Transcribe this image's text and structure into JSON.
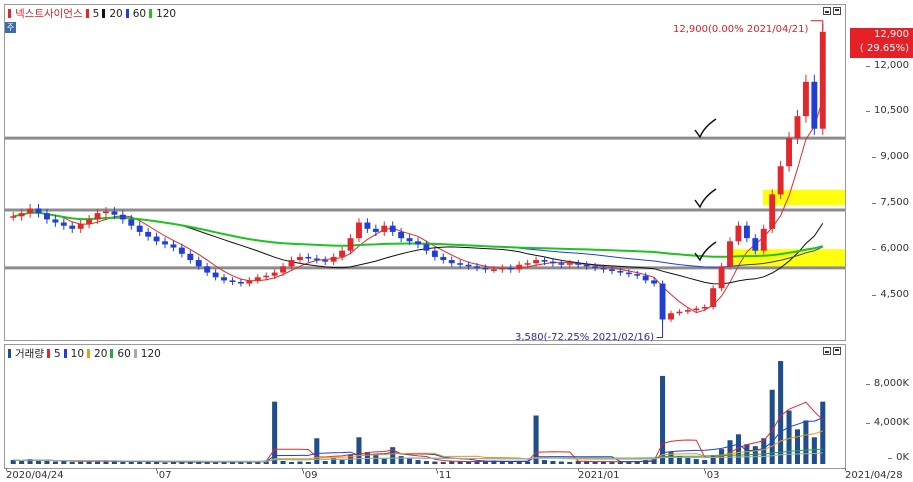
{
  "price_legend": {
    "stock_name": "넥스트사이언스",
    "ma": [
      {
        "label": "5",
        "color": "#e0282d"
      },
      {
        "label": "20",
        "color": "#111111"
      },
      {
        "label": "60",
        "color": "#1f3fd6"
      },
      {
        "label": "120",
        "color": "#1fc21f"
      }
    ]
  },
  "volume_legend": {
    "title": "거래량",
    "ma": [
      {
        "label": "5",
        "color": "#e0282d"
      },
      {
        "label": "10",
        "color": "#1f3fd6"
      },
      {
        "label": "20",
        "color": "#e79b18"
      },
      {
        "label": "60",
        "color": "#22a845"
      },
      {
        "label": "120",
        "color": "#a9a9a9"
      }
    ]
  },
  "side_icon": "주",
  "annotations": {
    "high": "12,900(0.00% 2021/04/21)",
    "low": "3,580(-72.25% 2021/02/16)"
  },
  "current_price": {
    "price": "12,900",
    "change": "( 29.65%)"
  },
  "price_axis_labels": [
    "12,000",
    "10,500",
    "9,000",
    "7,500",
    "6,000",
    "4,500"
  ],
  "volume_axis_labels": [
    "8,000K",
    "4,000K",
    "0K"
  ],
  "date_labels": [
    "2020/04/24",
    "'07",
    "'09",
    "'11",
    "2021/01",
    "'03",
    "2021/04/28"
  ],
  "colors": {
    "up": "#e0282d",
    "down": "#1f3fd6",
    "volume_bar": "#1f4e8a",
    "hline": "#8c8c8c",
    "highlight": "#ffff00"
  },
  "chart_data": [
    {
      "type": "candlestick",
      "title": "넥스트사이언스",
      "series_names": [
        "5",
        "20",
        "60",
        "120"
      ],
      "date_range": [
        "2020-04-24",
        "2021-04-28"
      ],
      "ylim": [
        3300,
        13500
      ],
      "close": [
        7000,
        7100,
        7250,
        7100,
        6900,
        6800,
        6700,
        6600,
        6750,
        6900,
        7100,
        7150,
        7050,
        6900,
        6700,
        6500,
        6350,
        6200,
        6100,
        6000,
        5800,
        5600,
        5400,
        5200,
        5050,
        4950,
        4900,
        4850,
        4950,
        5050,
        5100,
        5200,
        5400,
        5600,
        5700,
        5650,
        5600,
        5550,
        5700,
        5900,
        6300,
        6800,
        6600,
        6500,
        6700,
        6500,
        6300,
        6200,
        6100,
        5900,
        5700,
        5600,
        5500,
        5450,
        5400,
        5350,
        5300,
        5300,
        5350,
        5300,
        5450,
        5500,
        5600,
        5550,
        5500,
        5450,
        5500,
        5450,
        5400,
        5350,
        5300,
        5250,
        5200,
        5150,
        5100,
        4950,
        4850,
        3700,
        3900,
        3950,
        4000,
        4050,
        4100,
        4700,
        5400,
        6200,
        6700,
        6300,
        5900,
        6600,
        7700,
        8600,
        9500,
        10200,
        11300,
        9800,
        12900
      ],
      "annotations": [
        {
          "text": "12,900(0.00% 2021/04/21)",
          "date": "2021-04-21",
          "value": 12900
        },
        {
          "text": "3,580(-72.25% 2021/02/16)",
          "date": "2021-02-16",
          "value": 3580
        }
      ],
      "horizontal_lines": [
        9500,
        7200,
        5350
      ],
      "highlight_zones": [
        [
          7350,
          7850
        ],
        [
          5400,
          5950
        ]
      ],
      "current_price": 12900,
      "current_change_pct": 29.65
    },
    {
      "type": "bar",
      "title": "거래량",
      "unit": "K",
      "series_names": [
        "5",
        "10",
        "20",
        "60",
        "120"
      ],
      "ylim": [
        0,
        10000
      ],
      "values": [
        400,
        300,
        500,
        350,
        300,
        250,
        300,
        200,
        250,
        300,
        350,
        300,
        250,
        200,
        200,
        300,
        250,
        200,
        150,
        200,
        200,
        250,
        200,
        200,
        150,
        200,
        300,
        200,
        250,
        300,
        350,
        6300,
        300,
        200,
        250,
        200,
        2600,
        300,
        600,
        400,
        900,
        2700,
        1200,
        900,
        600,
        1700,
        800,
        600,
        400,
        300,
        250,
        200,
        300,
        250,
        200,
        300,
        250,
        350,
        250,
        200,
        300,
        250,
        4900,
        400,
        300,
        250,
        200,
        300,
        250,
        200,
        250,
        200,
        200,
        250,
        300,
        400,
        600,
        8900,
        1200,
        800,
        600,
        500,
        400,
        900,
        1500,
        2400,
        3000,
        2000,
        1800,
        2600,
        7500,
        10400,
        5400,
        3500,
        4400,
        2700,
        6300
      ]
    }
  ]
}
